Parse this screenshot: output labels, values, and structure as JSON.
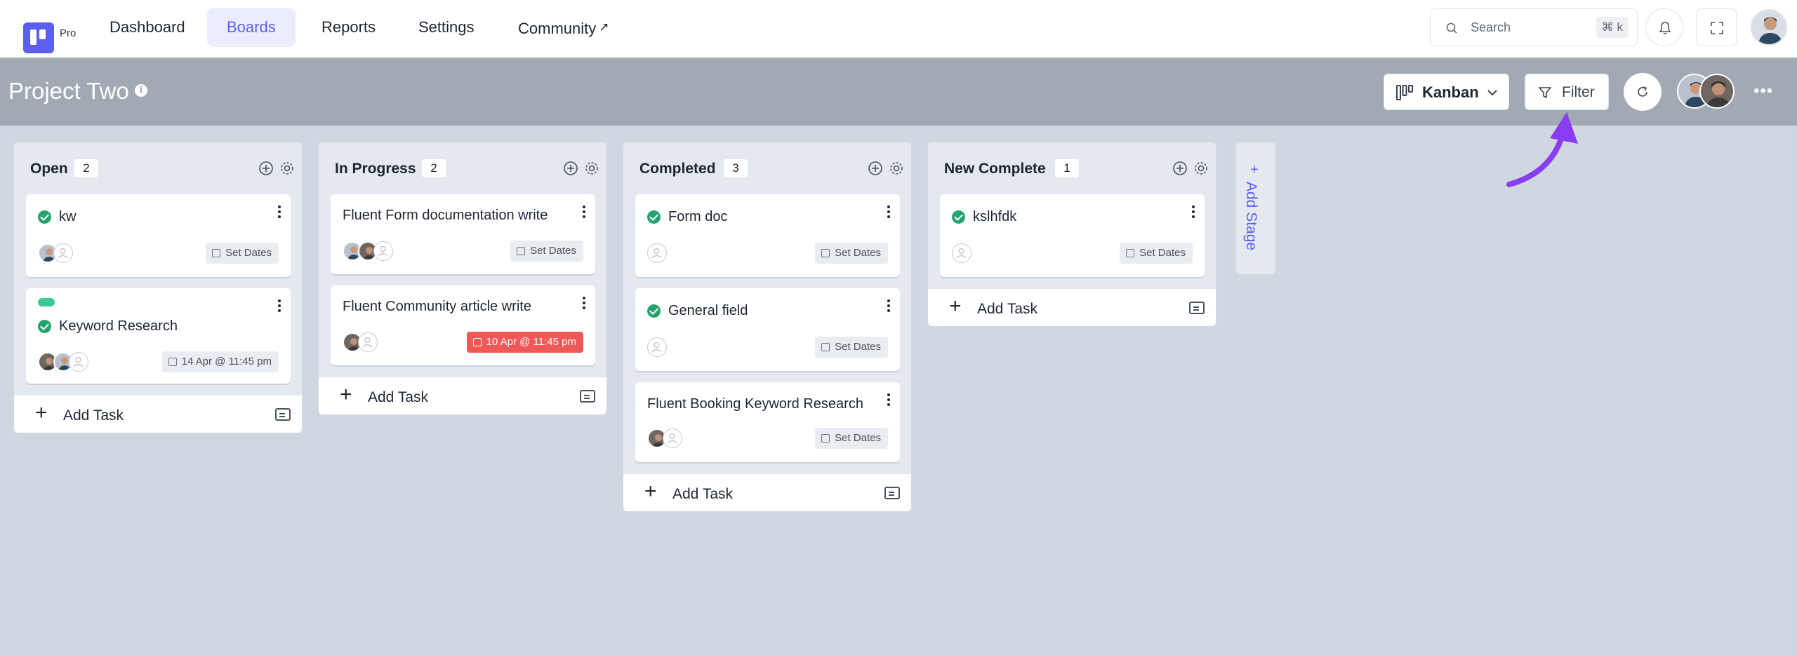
{
  "nav": {
    "brand_badge": "Pro",
    "items": [
      "Dashboard",
      "Boards",
      "Reports",
      "Settings",
      "Community"
    ],
    "active": "Boards",
    "external_icon": "↗",
    "search_placeholder": "Search",
    "search_shortcut": "⌘ k"
  },
  "header": {
    "title": "Project Two",
    "info_icon": "i",
    "view_label": "Kanban",
    "filter_label": "Filter",
    "more": "•••"
  },
  "columns": [
    {
      "title": "Open",
      "count": "2",
      "cards": [
        {
          "title": "kw",
          "done": true,
          "date": "Set Dates"
        },
        {
          "title": "Keyword Research",
          "done": true,
          "date": "14 Apr @ 11:45 pm",
          "label_color": "#3cc98f"
        }
      ],
      "add_task": "Add Task"
    },
    {
      "title": "In Progress",
      "count": "2",
      "cards": [
        {
          "title": "Fluent Form documentation write",
          "done": false,
          "date": "Set Dates"
        },
        {
          "title": "Fluent Community article write",
          "done": false,
          "date": "10 Apr @ 11:45 pm",
          "overdue": true
        }
      ],
      "add_task": "Add Task"
    },
    {
      "title": "Completed",
      "count": "3",
      "cards": [
        {
          "title": "Form doc",
          "done": true,
          "date": "Set Dates"
        },
        {
          "title": "General field",
          "done": true,
          "date": "Set Dates"
        },
        {
          "title": "Fluent Booking Keyword Research",
          "done": false,
          "date": "Set Dates"
        }
      ],
      "add_task": "Add Task"
    },
    {
      "title": "New Complete",
      "count": "1",
      "cards": [
        {
          "title": "kslhfdk",
          "done": true,
          "date": "Set Dates"
        }
      ],
      "add_task": "Add Task"
    }
  ],
  "add_stage": {
    "plus": "+",
    "label": "Add Stage"
  },
  "colors": {
    "accent": "#5a5ff0",
    "done": "#25a36f",
    "overdue": "#f05858",
    "header_bg": "#a1a9b3",
    "board_bg": "#cfd7e0",
    "annotation_arrow": "#8a3cf0"
  }
}
